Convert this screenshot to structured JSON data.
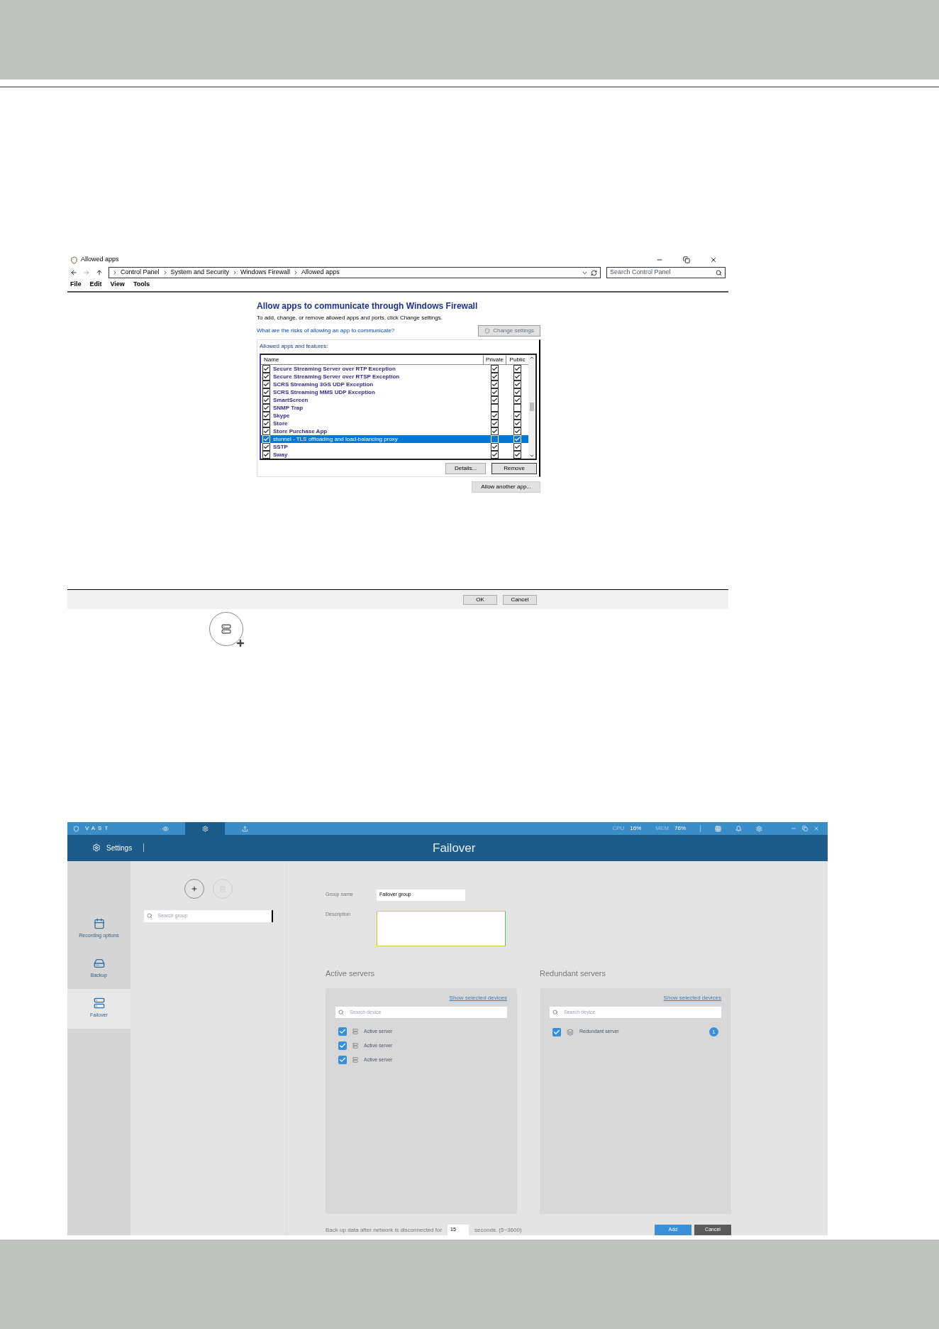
{
  "firewall_window": {
    "title": "Allowed apps",
    "breadcrumb": [
      "Control Panel",
      "System and Security",
      "Windows Firewall",
      "Allowed apps"
    ],
    "search_placeholder": "Search Control Panel",
    "menu": [
      "File",
      "Edit",
      "View",
      "Tools"
    ],
    "heading": "Allow apps to communicate through Windows Firewall",
    "instruction": "To add, change, or remove allowed apps and ports, click Change settings.",
    "risk_link": "What are the risks of allowing an app to communicate?",
    "change_settings": "Change settings",
    "list_title": "Allowed apps and features:",
    "columns": [
      "Name",
      "Private",
      "Public"
    ],
    "apps": [
      {
        "name": "Secure Streaming Server over RTP Exception",
        "private": true,
        "public": true,
        "selected": false
      },
      {
        "name": "Secure Streaming Server over RTSP Exception",
        "private": true,
        "public": true,
        "selected": false
      },
      {
        "name": "SCRS Streaming 3GS UDP Exception",
        "private": true,
        "public": true,
        "selected": false
      },
      {
        "name": "SCRS Streaming MMS UDP Exception",
        "private": true,
        "public": true,
        "selected": false
      },
      {
        "name": "SmartScreen",
        "private": true,
        "public": true,
        "selected": false
      },
      {
        "name": "SNMP Trap",
        "private": false,
        "public": false,
        "selected": false
      },
      {
        "name": "Skype",
        "private": true,
        "public": true,
        "selected": false
      },
      {
        "name": "Store",
        "private": true,
        "public": true,
        "selected": false
      },
      {
        "name": "Store Purchase App",
        "private": true,
        "public": true,
        "selected": false
      },
      {
        "name": "stunnel - TLS offloading and load-balancing proxy",
        "private": false,
        "public": true,
        "selected": true
      },
      {
        "name": "SSTP",
        "private": true,
        "public": true,
        "selected": false
      },
      {
        "name": "Sway",
        "private": true,
        "public": true,
        "selected": false
      }
    ],
    "details": "Details...",
    "remove": "Remove",
    "allow_another": "Allow another app...",
    "footer_buttons": [
      "OK",
      "Cancel"
    ]
  },
  "vms_window": {
    "brand": "VAST",
    "top_tabs": [
      {
        "kind": "eye",
        "selected": false
      },
      {
        "kind": "settings",
        "selected": true
      },
      {
        "kind": "export",
        "selected": false
      }
    ],
    "cpu_label": "CPU",
    "cpu": "16%",
    "mem_label": "MEM",
    "mem": "76%",
    "section": "Settings",
    "page_title": "Failover",
    "sidebar": [
      {
        "label": "Recording options",
        "kind": "calendar",
        "selected": false
      },
      {
        "label": "Backup",
        "kind": "drive",
        "selected": false
      },
      {
        "label": "Failover",
        "kind": "server",
        "selected": true
      }
    ],
    "group_search_placeholder": "Search group",
    "group_name_label": "Group name",
    "group_name": "Failover group",
    "description_label": "Description",
    "active": {
      "title": "Active servers",
      "show_selected": "Show selected devices",
      "search_placeholder": "Search device",
      "servers": [
        {
          "name": "Active server",
          "checked": true
        },
        {
          "name": "Active server",
          "checked": true
        },
        {
          "name": "Active server",
          "checked": true
        }
      ]
    },
    "redundant": {
      "title": "Redundant servers",
      "show_selected": "Show selected devices",
      "search_placeholder": "Search device",
      "servers": [
        {
          "name": "Redundant server",
          "checked": true,
          "badge": "1"
        }
      ]
    },
    "backup_label": "Back up data after network is disconnected for",
    "backup_seconds": "15",
    "backup_unit": "seconds. (5~3600)",
    "buttons": [
      {
        "label": "Add",
        "kind": "primary"
      },
      {
        "label": "Cancel",
        "kind": "secondary"
      }
    ]
  }
}
